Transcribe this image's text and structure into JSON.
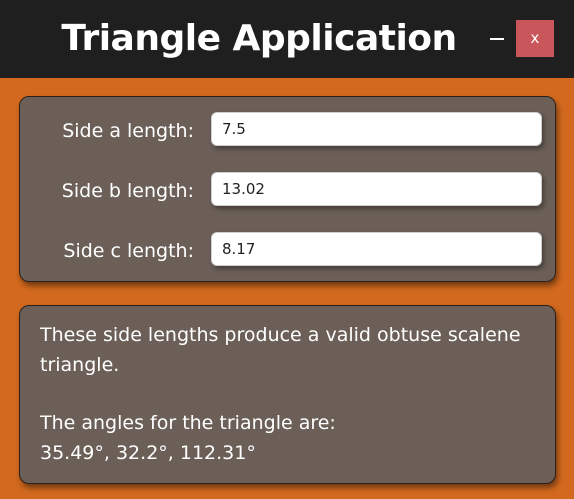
{
  "window": {
    "title": "Triangle Application",
    "minimize_label": "—",
    "close_label": "x"
  },
  "inputs": {
    "side_a": {
      "label": "Side a length:",
      "value": "7.5"
    },
    "side_b": {
      "label": "Side b length:",
      "value": "13.02"
    },
    "side_c": {
      "label": "Side c length:",
      "value": "8.17"
    }
  },
  "result": {
    "validity_text": "These side lengths produce a valid obtuse scalene triangle.",
    "angles_heading": "The angles for the triangle are:",
    "angles_values": "35.49°, 32.2°, 112.31°"
  },
  "colors": {
    "background": "#d2691e",
    "titlebar": "#1f1f1f",
    "panel": "#6b5f58",
    "close_button": "#c9565a"
  }
}
